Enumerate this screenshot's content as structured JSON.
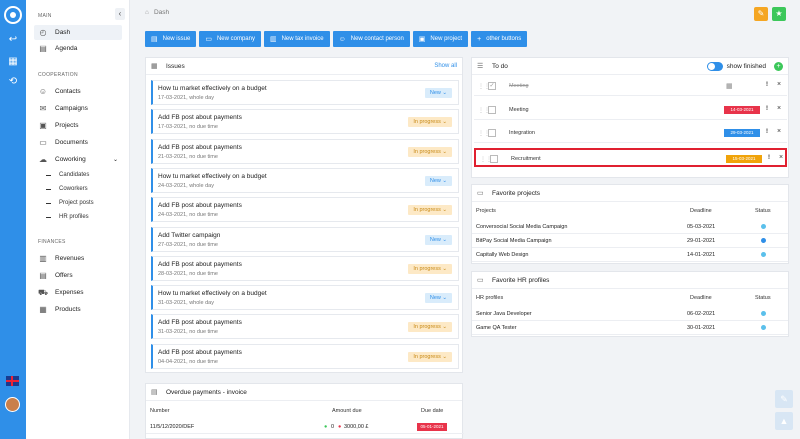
{
  "sidebar": {
    "main_label": "MAIN",
    "dash": "Dash",
    "agenda": "Agenda",
    "cooperation_label": "COOPERATION",
    "contacts": "Contacts",
    "campaigns": "Campaigns",
    "projects": "Projects",
    "documents": "Documents",
    "coworking": "Coworking",
    "sub": [
      "Candidates",
      "Coworkers",
      "Project posts",
      "HR profiles"
    ],
    "finances_label": "FINANCES",
    "revenues": "Revenues",
    "offers": "Offers",
    "expenses": "Expenses",
    "products": "Products"
  },
  "header": {
    "breadcrumb": "Dash"
  },
  "actions": [
    "New issue",
    "New company",
    "New tax invoice",
    "New contact person",
    "New project",
    "other buttons"
  ],
  "issues": {
    "title": "Issues",
    "show_all": "Show all",
    "items": [
      {
        "title": "How tu market effectively on a budget",
        "date": "17-03-2021, whole day",
        "status": "New"
      },
      {
        "title": "Add FB post about payments",
        "date": "17-03-2021, no due time",
        "status": "In progress"
      },
      {
        "title": "Add FB post about payments",
        "date": "21-03-2021, no due time",
        "status": "In progress"
      },
      {
        "title": "How tu market effectively on a budget",
        "date": "24-03-2021, whole day",
        "status": "New"
      },
      {
        "title": "Add FB post about payments",
        "date": "24-03-2021, no due time",
        "status": "In progress"
      },
      {
        "title": "Add Twitter campaign",
        "date": "27-03-2021, no due time",
        "status": "New"
      },
      {
        "title": "Add FB post about payments",
        "date": "28-03-2021, no due time",
        "status": "In progress"
      },
      {
        "title": "How tu market effectively on a budget",
        "date": "31-03-2021, whole day",
        "status": "New"
      },
      {
        "title": "Add FB post about payments",
        "date": "31-03-2021, no due time",
        "status": "In progress"
      },
      {
        "title": "Add FB post about payments",
        "date": "04-04-2021, no due time",
        "status": "In progress"
      }
    ]
  },
  "overdue": {
    "title": "Overdue payments - invoice",
    "headers": [
      "Number",
      "Amount due",
      "Due date"
    ],
    "rows": [
      {
        "number": "11/5/12/2020/DEF",
        "amount_a": "0",
        "amount_b": "3000,00 £",
        "due": "05-01-2021"
      }
    ]
  },
  "todo": {
    "title": "To do",
    "toggle_label": "show finished",
    "items": [
      {
        "label": "Meeting",
        "date": "",
        "done": true
      },
      {
        "label": "Meeting",
        "date": "14-03-2021",
        "date_color": "#e8334a",
        "done": false
      },
      {
        "label": "Integration",
        "date": "29-03-2021",
        "date_color": "#2f8fe8",
        "done": false
      },
      {
        "label": "Recruitment",
        "date": "15-03-2021",
        "date_color": "#f0a30a",
        "done": false
      }
    ]
  },
  "fav_projects": {
    "title": "Favorite projects",
    "headers": [
      "Projects",
      "Deadline",
      "Status"
    ],
    "rows": [
      {
        "name": "Conversocial Social Media Campaign",
        "deadline": "05-03-2021",
        "status_color": "#5bc0eb"
      },
      {
        "name": "BitPay Social Media Campaign",
        "deadline": "29-01-2021",
        "status_color": "#2f8fe8"
      },
      {
        "name": "Capitally Web Design",
        "deadline": "14-01-2021",
        "status_color": "#5bc0eb"
      }
    ]
  },
  "fav_hr": {
    "title": "Favorite HR profiles",
    "headers": [
      "HR profiles",
      "Deadline",
      "Status"
    ],
    "rows": [
      {
        "name": "Senior Java Developer",
        "deadline": "06-02-2021",
        "status_color": "#5bc0eb"
      },
      {
        "name": "Game QA Tester",
        "deadline": "30-01-2021",
        "status_color": "#5bc0eb"
      }
    ]
  },
  "colors": {
    "accent": "#2f8fe8",
    "warn": "#f5a623",
    "ok": "#3cc75a"
  }
}
